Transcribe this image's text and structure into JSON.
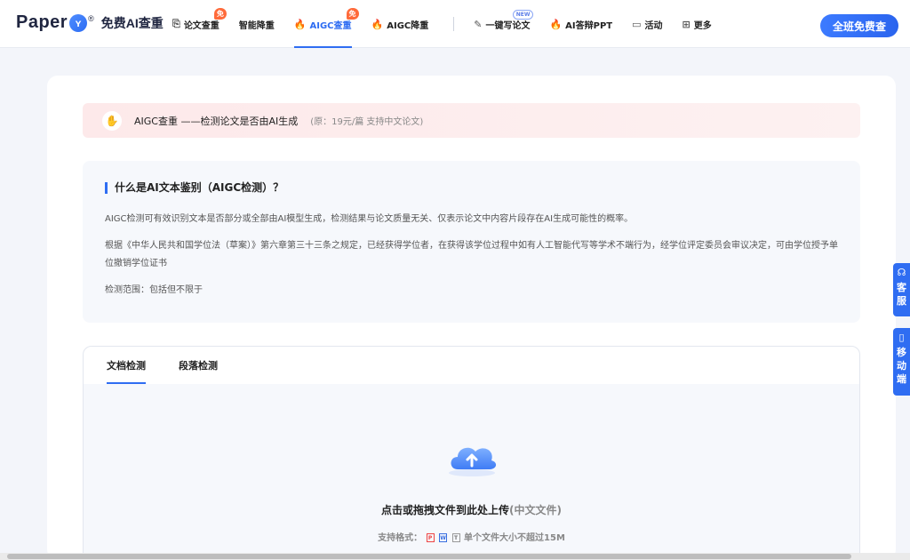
{
  "header": {
    "logo_word": "Paper",
    "logo_badge": "ʏ",
    "logo_reg": "®",
    "logo_sub": "免费AI查重",
    "nav": [
      {
        "label": "论文查重",
        "badge": "免"
      },
      {
        "label": "智能降重"
      },
      {
        "label": "AIGC查重",
        "badge": "免"
      },
      {
        "label": "AIGC降重"
      },
      {
        "label": "一键写论文",
        "badge": "NEW"
      },
      {
        "label": "AI答辩PPT"
      },
      {
        "label": "活动"
      },
      {
        "label": "更多"
      }
    ],
    "cta": "全班免费查"
  },
  "notice": {
    "title": "AIGC查重 ——检测论文是否由AI生成",
    "note": "(原：19元/篇 支持中文论文)"
  },
  "info": {
    "title": "什么是AI文本鉴别（AIGC检测）？",
    "p1": "AIGC检测可有效识别文本是否部分或全部由AI模型生成，检测结果与论文质量无关、仅表示论文中内容片段存在AI生成可能性的概率。",
    "p2": "根据《中华人民共和国学位法（草案）》第六章第三十三条之规定，已经获得学位者，在获得该学位过程中如有人工智能代写等学术不端行为，经学位评定委员会审议决定，可由学位授予单位撤销学位证书",
    "p3": "检测范围：包括但不限于"
  },
  "upload": {
    "tabs": [
      "文档检测",
      "段落检测"
    ],
    "main": "点击或拖拽文件到此处上传",
    "main_muted": "(中文文件)",
    "sub_label": "支持格式：",
    "fmt_pdf": "P",
    "fmt_word": "W",
    "fmt_txt": "T",
    "sub_size": "单个文件大小不超过15M"
  },
  "side": {
    "service": [
      "客",
      "服"
    ],
    "mobile": [
      "移",
      "动",
      "端"
    ]
  },
  "colors": {
    "accent": "#2f6df2",
    "notice_bg": "#fde9ea",
    "badge": "#ff6a3a"
  }
}
